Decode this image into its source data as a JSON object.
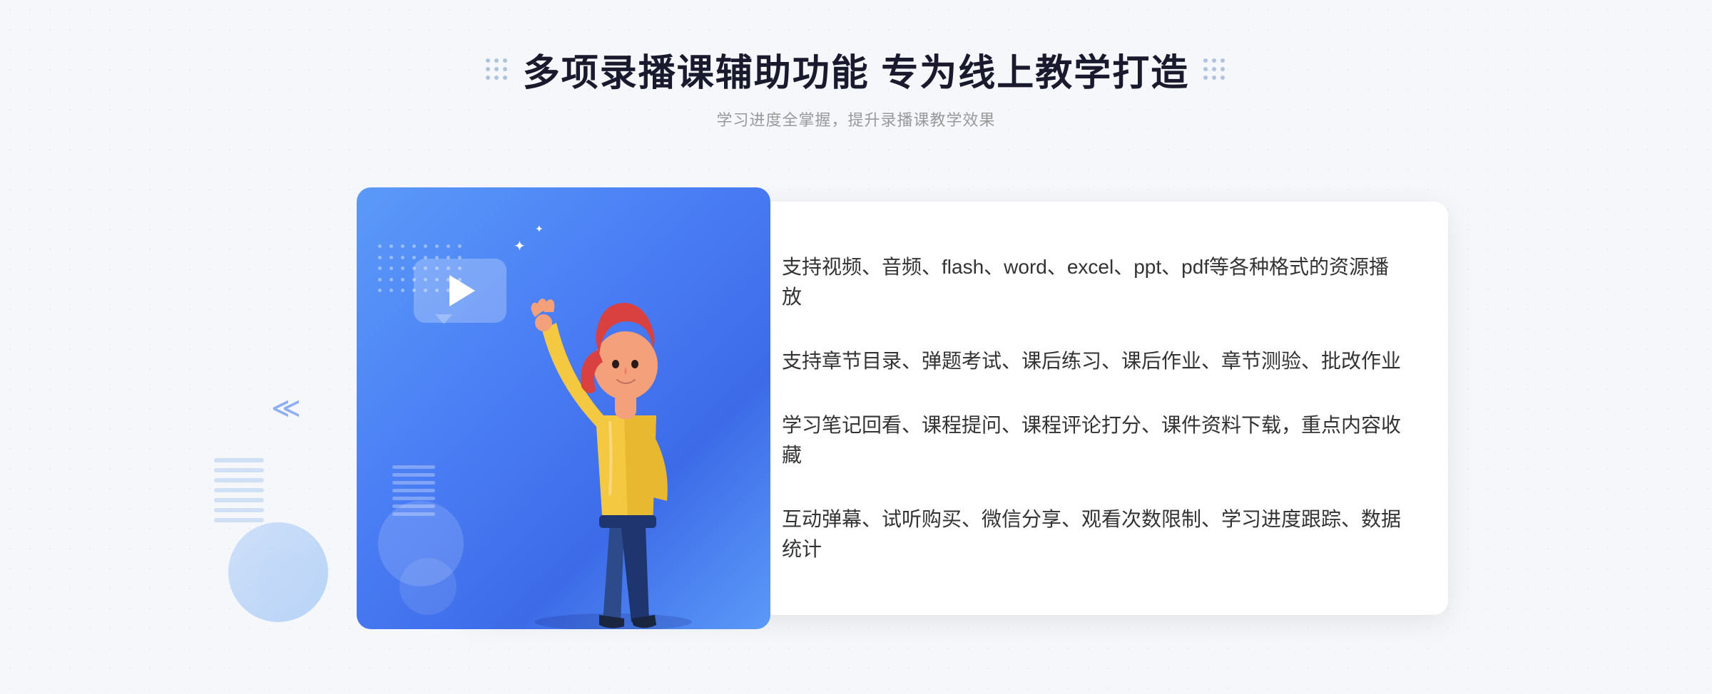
{
  "header": {
    "main_title": "多项录播课辅助功能 专为线上教学打造",
    "subtitle": "学习进度全掌握，提升录播课教学效果",
    "decoration_dots": true
  },
  "features": [
    {
      "id": 1,
      "text": "支持视频、音频、flash、word、excel、ppt、pdf等各种格式的资源播放"
    },
    {
      "id": 2,
      "text": "支持章节目录、弹题考试、课后练习、课后作业、章节测验、批改作业"
    },
    {
      "id": 3,
      "text": "学习笔记回看、课程提问、课程评论打分、课件资料下载，重点内容收藏"
    },
    {
      "id": 4,
      "text": "互动弹幕、试听购买、微信分享、观看次数限制、学习进度跟踪、数据统计"
    }
  ],
  "icons": {
    "check": "check-circle",
    "play": "play-triangle",
    "arrow_left": "double-chevron-left"
  },
  "colors": {
    "primary_blue": "#4a7ef5",
    "light_blue": "#5b9af8",
    "text_dark": "#1a1a2e",
    "text_medium": "#333333",
    "text_light": "#999999",
    "bg": "#f5f7fa",
    "white": "#ffffff"
  }
}
